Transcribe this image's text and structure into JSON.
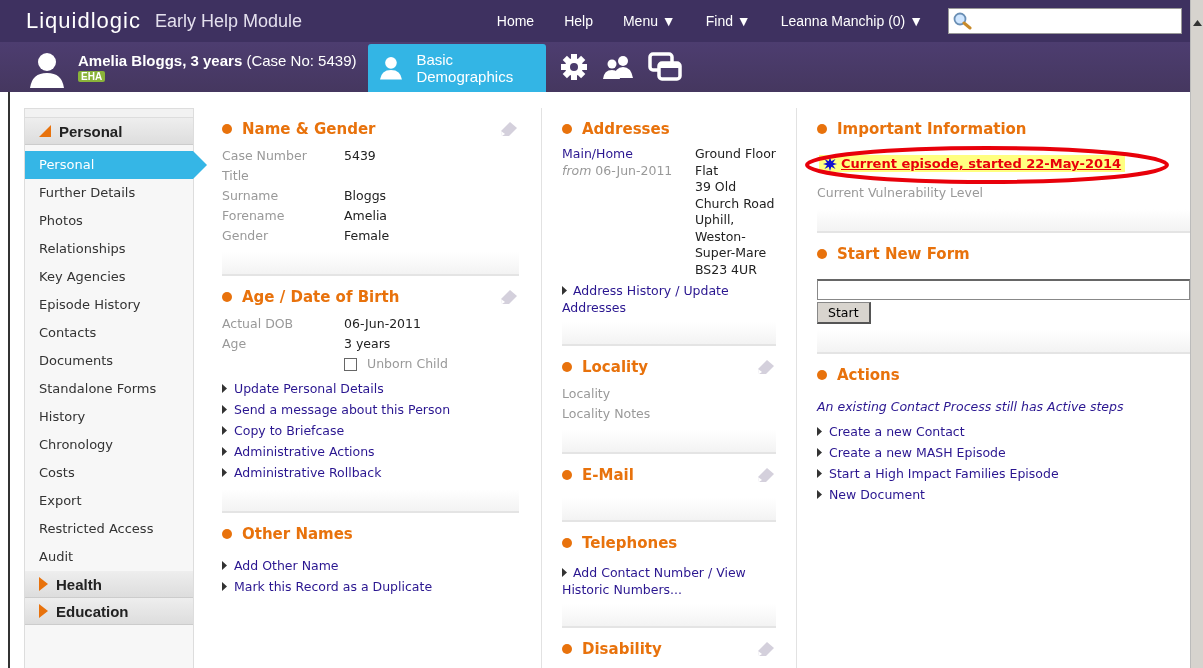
{
  "header": {
    "logo": "Liquidlogic",
    "module": "Early Help Module",
    "nav": [
      "Home",
      "Help",
      "Menu ▼",
      "Find ▼",
      "Leanna Manchip (0) ▼"
    ]
  },
  "person": {
    "name": "Amelia Bloggs, 3 years",
    "case": "(Case No: 5439)",
    "badge": "EHA",
    "tabs": [
      {
        "label": "Basic Demographics",
        "selected": true
      }
    ]
  },
  "sidebar": {
    "groups": [
      {
        "label": "Personal",
        "expanded": true,
        "items": [
          {
            "label": "Personal",
            "selected": true
          },
          {
            "label": "Further Details",
            "selected": false
          },
          {
            "label": "Photos",
            "selected": false
          },
          {
            "label": "Relationships",
            "selected": false
          },
          {
            "label": "Key Agencies",
            "selected": false
          },
          {
            "label": "Episode History",
            "selected": false
          },
          {
            "label": "Contacts",
            "selected": false
          },
          {
            "label": "Documents",
            "selected": false
          },
          {
            "label": "Standalone Forms",
            "selected": false
          },
          {
            "label": "History",
            "selected": false
          },
          {
            "label": "Chronology",
            "selected": false
          },
          {
            "label": "Costs",
            "selected": false
          },
          {
            "label": "Export",
            "selected": false
          },
          {
            "label": "Restricted Access",
            "selected": false
          },
          {
            "label": "Audit",
            "selected": false
          }
        ]
      },
      {
        "label": "Health",
        "expanded": false
      },
      {
        "label": "Education",
        "expanded": false
      }
    ]
  },
  "columns": [
    [
      {
        "title": "Name & Gender",
        "editable": true,
        "fields": [
          {
            "label": "Case Number",
            "value": "5439"
          },
          {
            "label": "Title"
          },
          {
            "label": "Surname",
            "value": "Bloggs"
          },
          {
            "label": "Forename",
            "value": "Amelia"
          },
          {
            "label": "Gender",
            "value": "Female"
          }
        ]
      },
      {
        "title": "Age / Date of Birth",
        "editable": true,
        "fields": [
          {
            "label": "Actual DOB",
            "value": "06-Jun-2011"
          },
          {
            "label": "Age",
            "value": "3 years"
          }
        ],
        "checkbox": {
          "label": "Unborn Child",
          "checked": false
        },
        "links": [
          "Update Personal Details",
          "Send a message about this Person",
          "Copy to Briefcase",
          "Administrative Actions",
          "Administrative Rollback"
        ]
      },
      {
        "title": "Other Names",
        "editable": false,
        "links": [
          "Add Other Name",
          "Mark this Record as a Duplicate"
        ]
      }
    ],
    [
      {
        "title": "Addresses",
        "editable": false,
        "address": {
          "type": "Main/Home",
          "from": "*from* 06-Jun-2011",
          "lines": [
            "Ground Floor",
            "Flat",
            "39 Old",
            "Church Road",
            "Uphill,",
            "Weston-",
            "Super-Mare",
            "BS23 4UR"
          ]
        },
        "links": [
          "Address History / Update Addresses"
        ]
      },
      {
        "title": "Locality",
        "editable": true,
        "fields": [
          {
            "label": "Locality"
          },
          {
            "label": "Locality Notes"
          }
        ]
      },
      {
        "title": "E-Mail",
        "editable": true
      },
      {
        "title": "Telephones",
        "editable": false,
        "links": [
          "Add Contact Number / View Historic Numbers..."
        ]
      },
      {
        "title": "Disability",
        "editable": true
      }
    ],
    [
      {
        "title": "Important Information",
        "editable": false,
        "alert": "Current episode, started 22-May-2014",
        "circled": true,
        "fields": [
          {
            "label": "Current Vulnerability Level"
          }
        ]
      },
      {
        "title": "Start New Form",
        "editable": false,
        "form": {
          "button": "Start"
        }
      },
      {
        "title": "Actions",
        "editable": false,
        "note": "An existing Contact Process still has Active steps",
        "links": [
          "Create a new Contact",
          "Create a new MASH Episode",
          "Start a High Impact Families Episode",
          "New Document"
        ]
      }
    ]
  ]
}
